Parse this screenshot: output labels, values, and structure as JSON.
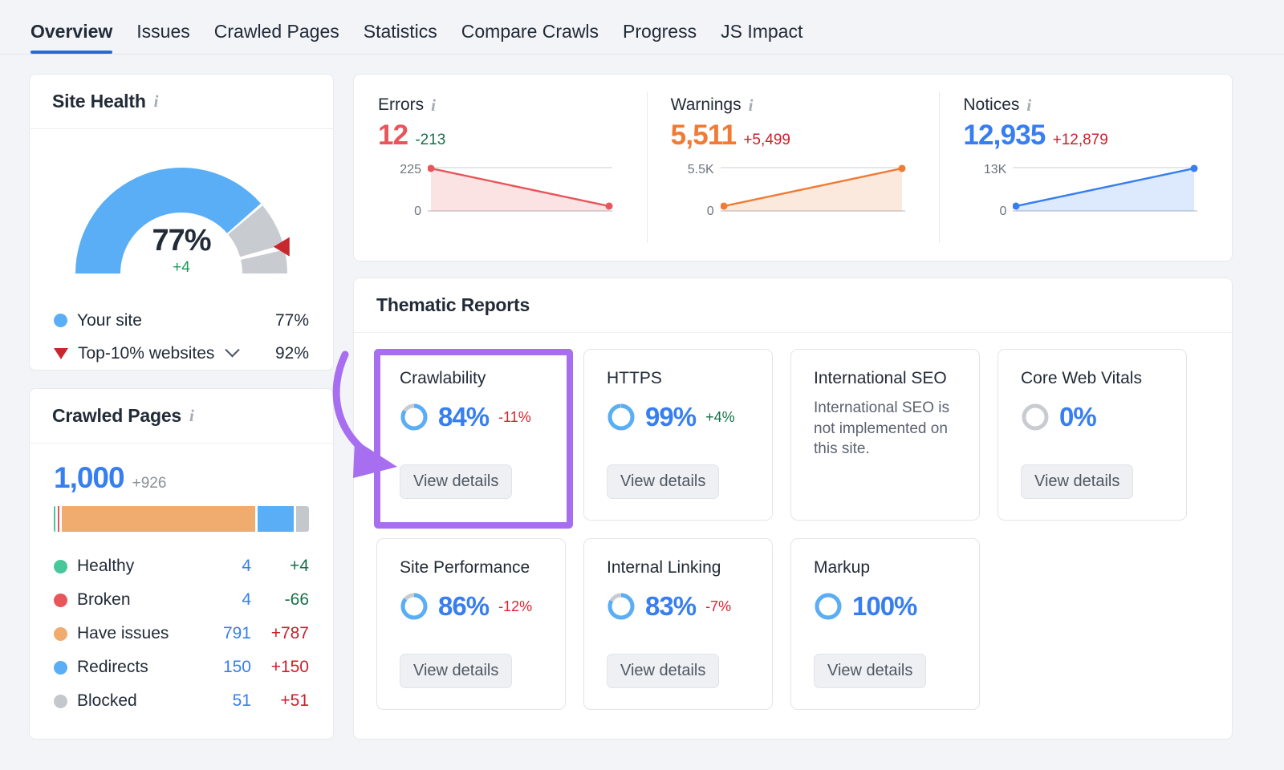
{
  "tabs": [
    {
      "label": "Overview",
      "active": true
    },
    {
      "label": "Issues",
      "active": false
    },
    {
      "label": "Crawled Pages",
      "active": false
    },
    {
      "label": "Statistics",
      "active": false
    },
    {
      "label": "Compare Crawls",
      "active": false
    },
    {
      "label": "Progress",
      "active": false
    },
    {
      "label": "JS Impact",
      "active": false
    }
  ],
  "site_health": {
    "title": "Site Health",
    "info_icon": "info-icon",
    "gauge_value": "77%",
    "gauge_delta": "+4",
    "rows": [
      {
        "label": "Your site",
        "value": "77%",
        "marker": "dot",
        "color": "#5aaef5"
      },
      {
        "label": "Top-10% websites",
        "value": "92%",
        "marker": "triangle",
        "color": "#c8272d"
      }
    ]
  },
  "crawled_pages": {
    "title": "Crawled Pages",
    "info_icon": "info-icon",
    "total": "1,000",
    "total_delta": "+926",
    "rows": [
      {
        "label": "Healthy",
        "value": "4",
        "delta": "+4",
        "delta_dir": "good",
        "color": "#47c79a",
        "share": 0.6
      },
      {
        "label": "Broken",
        "value": "4",
        "delta": "-66",
        "delta_dir": "good",
        "color": "#e8555a",
        "share": 0.6
      },
      {
        "label": "Have issues",
        "value": "791",
        "delta": "+787",
        "delta_dir": "bad",
        "color": "#f0ab6e",
        "share": 79.1
      },
      {
        "label": "Redirects",
        "value": "150",
        "delta": "+150",
        "delta_dir": "bad",
        "color": "#5aaef5",
        "share": 15.0
      },
      {
        "label": "Blocked",
        "value": "51",
        "delta": "+51",
        "delta_dir": "bad",
        "color": "#c4c8cc",
        "share": 5.1
      }
    ]
  },
  "metrics": [
    {
      "label": "Errors",
      "value": "12",
      "delta": "-213",
      "delta_dir": "good",
      "value_color": "#e8555a",
      "axis_hi": "225",
      "axis_lo": "0",
      "trend": "down",
      "start_y": 0.02,
      "end_y": 1.0
    },
    {
      "label": "Warnings",
      "value": "5,511",
      "delta": "+5,499",
      "delta_dir": "bad",
      "value_color": "#f07b35",
      "axis_hi": "5.5K",
      "axis_lo": "0",
      "trend": "up",
      "start_y": 1.0,
      "end_y": 0.02
    },
    {
      "label": "Notices",
      "value": "12,935",
      "delta": "+12,879",
      "delta_dir": "bad",
      "value_color": "#377ef0",
      "axis_hi": "13K",
      "axis_lo": "0",
      "trend": "up",
      "start_y": 1.0,
      "end_y": 0.02
    }
  ],
  "thematic": {
    "title": "Thematic Reports",
    "button_label": "View details",
    "cards": [
      {
        "name": "Crawlability",
        "pct": "84%",
        "ring": 84,
        "delta": "-11%",
        "delta_dir": "bad",
        "note": null,
        "has_button": true,
        "highlighted": true
      },
      {
        "name": "HTTPS",
        "pct": "99%",
        "ring": 99,
        "delta": "+4%",
        "delta_dir": "good",
        "note": null,
        "has_button": true,
        "highlighted": false
      },
      {
        "name": "International SEO",
        "pct": null,
        "ring": null,
        "delta": null,
        "delta_dir": null,
        "note": "International SEO is not implemented on this site.",
        "has_button": false,
        "highlighted": false
      },
      {
        "name": "Core Web Vitals",
        "pct": "0%",
        "ring": 0,
        "delta": null,
        "delta_dir": null,
        "note": null,
        "has_button": true,
        "highlighted": false
      },
      {
        "name": "Site Performance",
        "pct": "86%",
        "ring": 86,
        "delta": "-12%",
        "delta_dir": "bad",
        "note": null,
        "has_button": true,
        "highlighted": false
      },
      {
        "name": "Internal Linking",
        "pct": "83%",
        "ring": 83,
        "delta": "-7%",
        "delta_dir": "bad",
        "note": null,
        "has_button": true,
        "highlighted": false
      },
      {
        "name": "Markup",
        "pct": "100%",
        "ring": 100,
        "delta": null,
        "delta_dir": null,
        "note": null,
        "has_button": true,
        "highlighted": false
      }
    ]
  },
  "annotation": {
    "highlight_color": "#a86ef0",
    "target": "Crawlability View details button"
  },
  "colors": {
    "accent_blue": "#377ef0",
    "tab_underline": "#2a66d9",
    "good_green": "#17704a",
    "bad_red": "#cc1f2a",
    "page_bg": "#f2f4f7"
  }
}
